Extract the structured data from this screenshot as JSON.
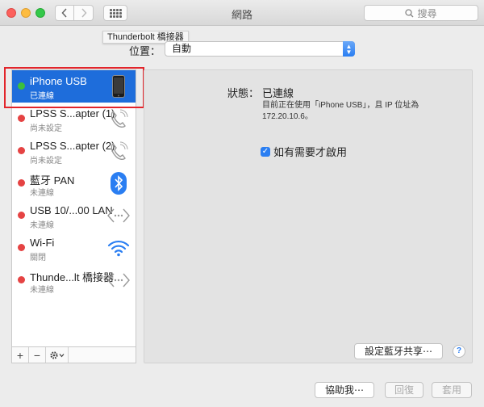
{
  "window": {
    "title": "網路"
  },
  "toolbar": {
    "search_placeholder": "搜尋"
  },
  "tooltip": {
    "text": "Thunderbolt 橋接器"
  },
  "location": {
    "label": "位置：",
    "value": "自動"
  },
  "services": [
    {
      "name": "iPhone USB",
      "status": "已連線",
      "dot": "#3cbf3c",
      "icon": "iphone-icon",
      "selected": true
    },
    {
      "name": "LPSS S...apter (1)",
      "status": "尚未設定",
      "dot": "#e54343",
      "icon": "phone-handset-icon"
    },
    {
      "name": "LPSS S...apter (2)",
      "status": "尚未設定",
      "dot": "#e54343",
      "icon": "phone-handset-icon"
    },
    {
      "name": "藍牙 PAN",
      "status": "未連線",
      "dot": "#e54343",
      "icon": "bluetooth-icon"
    },
    {
      "name": "USB 10/...00 LAN",
      "status": "未連線",
      "dot": "#e54343",
      "icon": "ethernet-icon"
    },
    {
      "name": "Wi-Fi",
      "status": "關閉",
      "dot": "#e54343",
      "icon": "wifi-icon"
    },
    {
      "name": "Thunde...lt 橋接器",
      "status": "未連線",
      "dot": "#e54343",
      "icon": "ethernet-icon"
    }
  ],
  "sidebar_toolbar": {
    "add": "+",
    "remove": "−"
  },
  "detail": {
    "status_label": "狀態：",
    "status_value": "已連線",
    "status_desc": "目前正在使用「iPhone USB」，且 IP 位址為 172.20.10.6。",
    "checkbox_label": "如有需要才啟用",
    "checkbox_checked": true,
    "bt_share_button": "設定藍牙共享⋯"
  },
  "footer": {
    "assist_button": "協助我⋯",
    "revert_button": "回復",
    "apply_button": "套用"
  },
  "colors": {
    "accent": "#2a7ef2",
    "selection": "#1e6ddb",
    "connected": "#3cbf3c",
    "disconnected": "#e54343"
  }
}
